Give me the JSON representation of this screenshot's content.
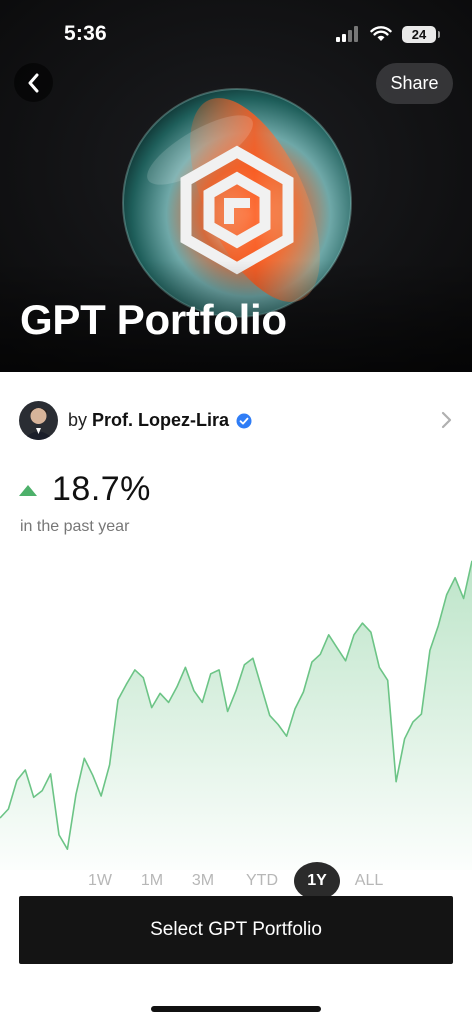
{
  "status_bar": {
    "time": "5:36",
    "battery": "24",
    "icons": [
      "signal-icon",
      "wifi-icon",
      "battery-icon"
    ]
  },
  "header": {
    "back_icon": "chevron-left-icon",
    "share_label": "Share",
    "title": "GPT Portfolio"
  },
  "author": {
    "prefix": "by",
    "name": "Prof. Lopez-Lira",
    "verified_icon": "verified-check-icon",
    "chevron_icon": "chevron-right-icon"
  },
  "performance": {
    "value": "18.7%",
    "direction_icon": "up-arrow-icon",
    "period": "in the past year",
    "color": "#4db06a"
  },
  "chart_data": {
    "type": "area",
    "color": "#6cc486",
    "grid": false,
    "series": [
      {
        "values": [
          100.5,
          101.2,
          103.4,
          104.2,
          102.1,
          102.6,
          103.9,
          99.2,
          98.1,
          102.3,
          105.1,
          103.8,
          102.2,
          104.6,
          109.6,
          110.8,
          111.9,
          111.3,
          109.0,
          110.1,
          109.4,
          110.6,
          112.1,
          110.3,
          109.4,
          111.6,
          111.9,
          108.7,
          110.3,
          112.3,
          112.8,
          110.6,
          108.4,
          107.7,
          106.8,
          108.9,
          110.2,
          112.5,
          113.1,
          114.6,
          113.6,
          112.6,
          114.6,
          115.5,
          114.8,
          112.1,
          111.1,
          103.3,
          106.6,
          107.9,
          108.5,
          113.4,
          115.3,
          117.7,
          119.0,
          117.4,
          120.3
        ]
      }
    ]
  },
  "range_tabs": {
    "items": [
      "1W",
      "1M",
      "3M",
      "YTD",
      "1Y",
      "ALL"
    ],
    "selected": "1Y"
  },
  "cta": {
    "label": "Select GPT Portfolio"
  }
}
